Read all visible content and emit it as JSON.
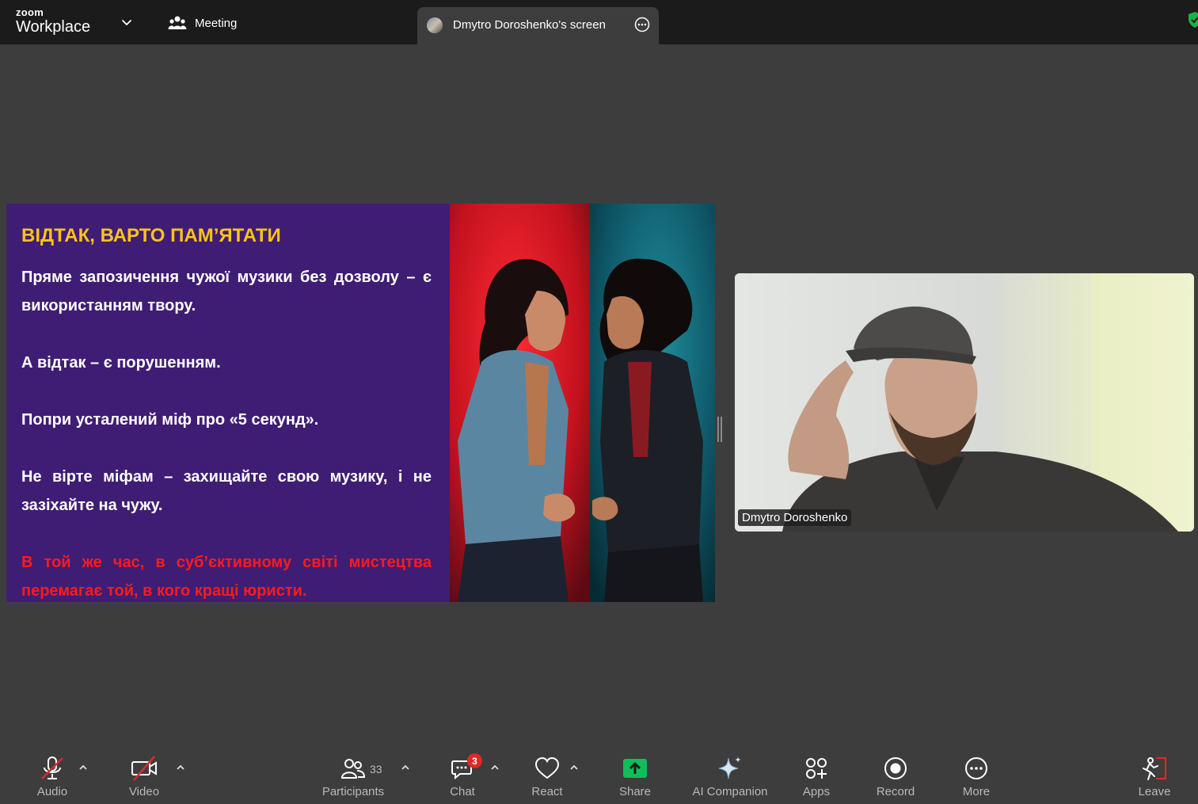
{
  "app": {
    "brand_small": "zoom",
    "brand_large": "Workplace"
  },
  "header": {
    "meeting_label": "Meeting",
    "screen_tab_label": "Dmytro Doroshenko's screen"
  },
  "slide": {
    "title": "ВІДТАК, ВАРТО ПАМ’ЯТАТИ",
    "paragraphs": [
      "Пряме запозичення чужої музики без дозволу – є використанням твору.",
      "А відтак – є порушенням.",
      "Попри усталений міф про «5 секунд».",
      "Не вірте міфам – захищайте свою музику, і не зазіхайте на чужу.",
      "В той же час, в суб’єктивному світі мистецтва перемагає той, в кого кращі юристи."
    ],
    "title_color": "#fbc318",
    "background_color": "#3f1d74",
    "warning_color": "#ff1a1a"
  },
  "video": {
    "participant_name": "Dmytro Doroshenko"
  },
  "toolbar": {
    "audio": "Audio",
    "video": "Video",
    "participants": "Participants",
    "participants_count": "33",
    "chat": "Chat",
    "chat_badge": "3",
    "react": "React",
    "share": "Share",
    "ai_companion": "AI Companion",
    "apps": "Apps",
    "record": "Record",
    "more": "More",
    "leave": "Leave"
  },
  "colors": {
    "share_green": "#0dbf5a",
    "alert_red": "#e02828",
    "secure_green": "#19b24a"
  },
  "icons": [
    "zoom-logo",
    "chevron-down-icon",
    "meeting-people-icon",
    "screen-share-thumb",
    "more-options-icon",
    "shield-check-icon",
    "mic-muted-icon",
    "video-off-icon",
    "participants-icon",
    "chat-icon",
    "heart-icon",
    "share-arrow-icon",
    "sparkle-icon",
    "apps-icon",
    "record-icon",
    "more-icon",
    "leave-icon"
  ]
}
